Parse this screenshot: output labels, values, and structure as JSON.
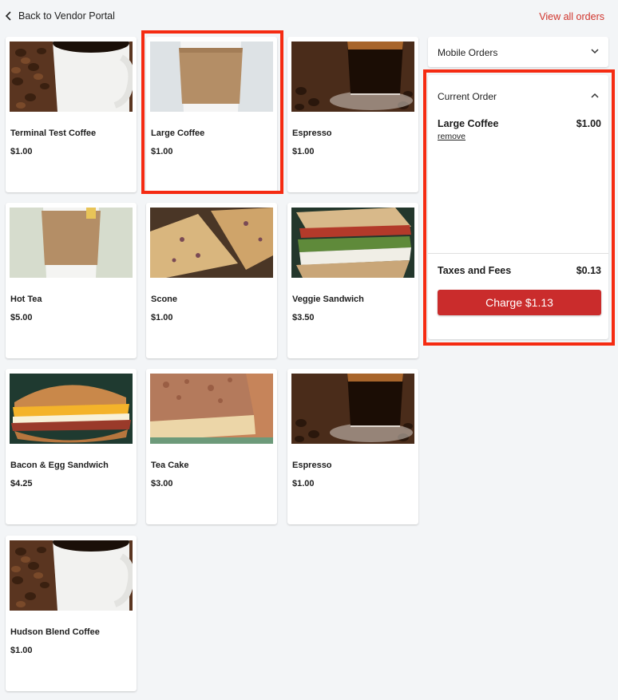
{
  "nav": {
    "back_label": "Back to Vendor Portal",
    "view_all_label": "View all orders"
  },
  "products": [
    {
      "name": "Terminal Test Coffee",
      "price": "$1.00",
      "image": "coffee-mug"
    },
    {
      "name": "Large Coffee",
      "price": "$1.00",
      "image": "paper-cup"
    },
    {
      "name": "Espresso",
      "price": "$1.00",
      "image": "espresso-glass"
    },
    {
      "name": "Hot Tea",
      "price": "$5.00",
      "image": "paper-cup"
    },
    {
      "name": "Scone",
      "price": "$1.00",
      "image": "scone"
    },
    {
      "name": "Veggie Sandwich",
      "price": "$3.50",
      "image": "panini"
    },
    {
      "name": "Bacon & Egg Sandwich",
      "price": "$4.25",
      "image": "breakfast-sandwich"
    },
    {
      "name": "Tea Cake",
      "price": "$3.00",
      "image": "coffee-cake"
    },
    {
      "name": "Espresso",
      "price": "$1.00",
      "image": "espresso-glass"
    },
    {
      "name": "Hudson Blend Coffee",
      "price": "$1.00",
      "image": "coffee-mug"
    }
  ],
  "mobile_orders": {
    "title": "Mobile Orders",
    "icon": "chevron-down-icon"
  },
  "current_order": {
    "title": "Current Order",
    "icon": "chevron-up-icon",
    "item": {
      "name": "Large Coffee",
      "price": "$1.00",
      "remove_label": "remove"
    },
    "taxes_label": "Taxes and Fees",
    "taxes_value": "$0.13",
    "charge_label": "Charge $1.13"
  },
  "colors": {
    "accent": "#ca2c2c",
    "link": "#d0342c",
    "highlight": "#f52b12",
    "background": "#f3f5f7"
  }
}
